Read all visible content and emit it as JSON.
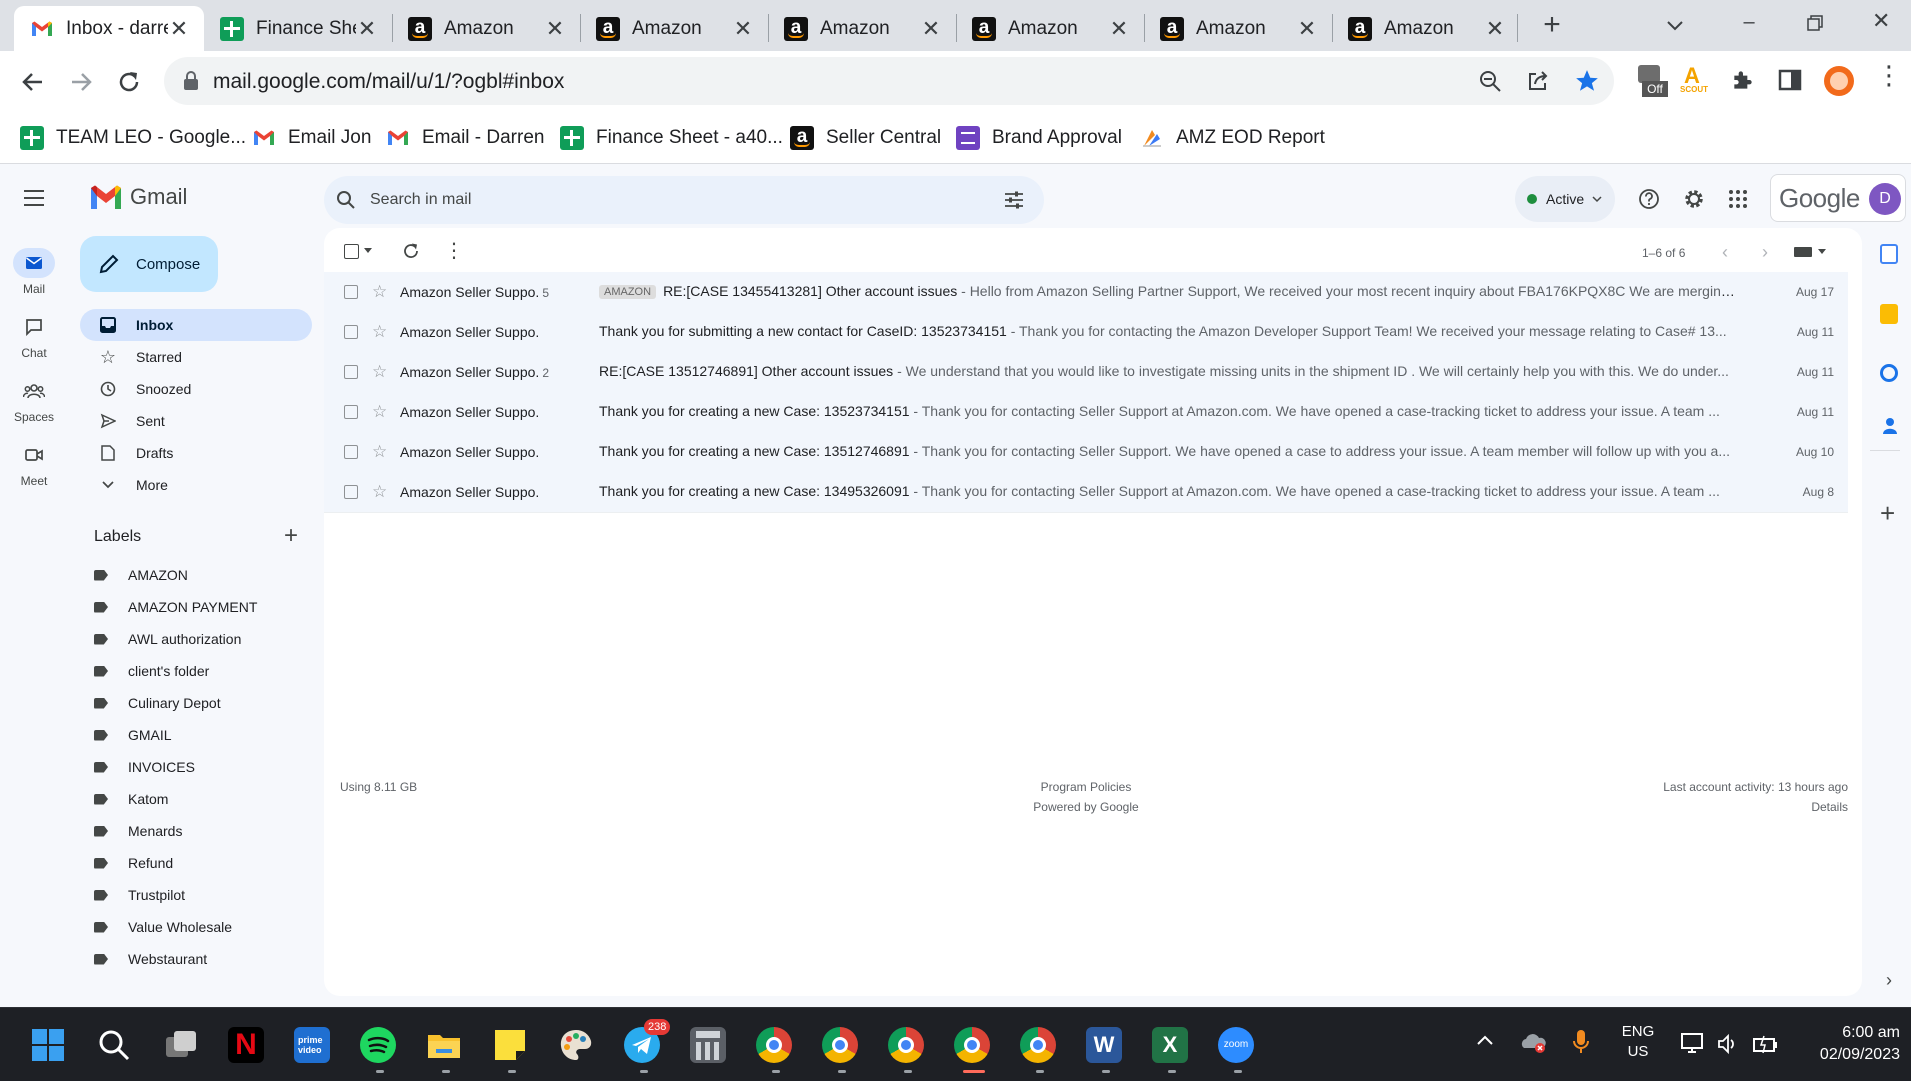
{
  "browser": {
    "tabs": [
      {
        "title": "Inbox - darren",
        "favicon": "gmail-icon",
        "active": true
      },
      {
        "title": "Finance Sheet",
        "favicon": "sheets-icon"
      },
      {
        "title": "Amazon",
        "favicon": "amazon-icon"
      },
      {
        "title": "Amazon",
        "favicon": "amazon-icon"
      },
      {
        "title": "Amazon",
        "favicon": "amazon-icon"
      },
      {
        "title": "Amazon",
        "favicon": "amazon-icon"
      },
      {
        "title": "Amazon",
        "favicon": "amazon-icon"
      },
      {
        "title": "Amazon",
        "favicon": "amazon-icon"
      }
    ],
    "url": "mail.google.com/mail/u/1/?ogbl#inbox",
    "extension_badge": "Off",
    "extension_scout_label": "SCOUT",
    "bookmarks": [
      {
        "label": "TEAM LEO - Google...",
        "icon": "sheets-icon"
      },
      {
        "label": "Email Jon",
        "icon": "gmail-icon"
      },
      {
        "label": "Email - Darren",
        "icon": "gmail-icon"
      },
      {
        "label": "Finance Sheet - a40...",
        "icon": "sheets-icon"
      },
      {
        "label": "Seller Central",
        "icon": "amazon-icon"
      },
      {
        "label": "Brand Approval",
        "icon": "forms-icon"
      },
      {
        "label": "AMZ EOD Report",
        "icon": "report-icon"
      }
    ]
  },
  "gmail": {
    "app_name": "Gmail",
    "rail": [
      {
        "label": "Mail",
        "icon": "mail-icon",
        "active": true
      },
      {
        "label": "Chat",
        "icon": "chat-icon"
      },
      {
        "label": "Spaces",
        "icon": "spaces-icon"
      },
      {
        "label": "Meet",
        "icon": "meet-icon"
      }
    ],
    "compose_label": "Compose",
    "nav": [
      {
        "label": "Inbox",
        "icon": "inbox-icon",
        "active": true
      },
      {
        "label": "Starred",
        "icon": "star-icon"
      },
      {
        "label": "Snoozed",
        "icon": "clock-icon"
      },
      {
        "label": "Sent",
        "icon": "send-icon"
      },
      {
        "label": "Drafts",
        "icon": "draft-icon"
      },
      {
        "label": "More",
        "icon": "chevron-down-icon"
      }
    ],
    "labels_header": "Labels",
    "labels": [
      "AMAZON",
      "AMAZON PAYMENT",
      "AWL authorization",
      "client's folder",
      "Culinary Depot",
      "GMAIL",
      "INVOICES",
      "Katom",
      "Menards",
      "Refund",
      "Trustpilot",
      "Value Wholesale",
      "Webstaurant"
    ],
    "search_placeholder": "Search in mail",
    "status": "Active",
    "google_wordmark": "Google",
    "avatar_letter": "D",
    "pagination": "1–6 of 6",
    "emails": [
      {
        "sender": "Amazon Seller Suppo.",
        "count": "5",
        "badge": "AMAZON",
        "subject": "RE:[CASE 13455413281] Other account issues",
        "snippet": " - Hello from Amazon Selling Partner Support, We received your most recent inquiry about FBA176KPQX8C We are merging ...",
        "date": "Aug 17"
      },
      {
        "sender": "Amazon Seller Suppo.",
        "count": "",
        "badge": "",
        "subject": "Thank you for submitting a new contact for CaseID: 13523734151",
        "snippet": " - Thank you for contacting the Amazon Developer Support Team! We received your message relating to Case# 13...",
        "date": "Aug 11"
      },
      {
        "sender": "Amazon Seller Suppo.",
        "count": "2",
        "badge": "",
        "subject": "RE:[CASE 13512746891] Other account issues",
        "snippet": " - We understand that you would like to investigate missing units in the shipment ID . We will certainly help you with this. We do under...",
        "date": "Aug 11"
      },
      {
        "sender": "Amazon Seller Suppo.",
        "count": "",
        "badge": "",
        "subject": "Thank you for creating a new Case: 13523734151",
        "snippet": " - Thank you for contacting Seller Support at Amazon.com. We have opened a case-tracking ticket to address your issue. A team ...",
        "date": "Aug 11"
      },
      {
        "sender": "Amazon Seller Suppo.",
        "count": "",
        "badge": "",
        "subject": "Thank you for creating a new Case: 13512746891",
        "snippet": " - Thank you for contacting Seller Support. We have opened a case to address your issue. A team member will follow up with you a...",
        "date": "Aug 10"
      },
      {
        "sender": "Amazon Seller Suppo.",
        "count": "",
        "badge": "",
        "subject": "Thank you for creating a new Case: 13495326091",
        "snippet": " - Thank you for contacting Seller Support at Amazon.com. We have opened a case-tracking ticket to address your issue. A team ...",
        "date": "Aug 8"
      }
    ],
    "footer": {
      "storage": "Using 8.11 GB",
      "policies": "Program Policies",
      "powered": "Powered by Google",
      "activity": "Last account activity: 13 hours ago",
      "details": "Details"
    }
  },
  "taskbar": {
    "telegram_badge": "238",
    "lang": "ENG",
    "region": "US",
    "time": "6:00 am",
    "date": "02/09/2023"
  },
  "colors": {
    "gmail_red": "#ea4335",
    "compose_bg": "#c2e7ff",
    "active_nav": "#d3e3fd",
    "chrome_star": "#1a73e8",
    "active_dot": "#1e8e3e"
  }
}
